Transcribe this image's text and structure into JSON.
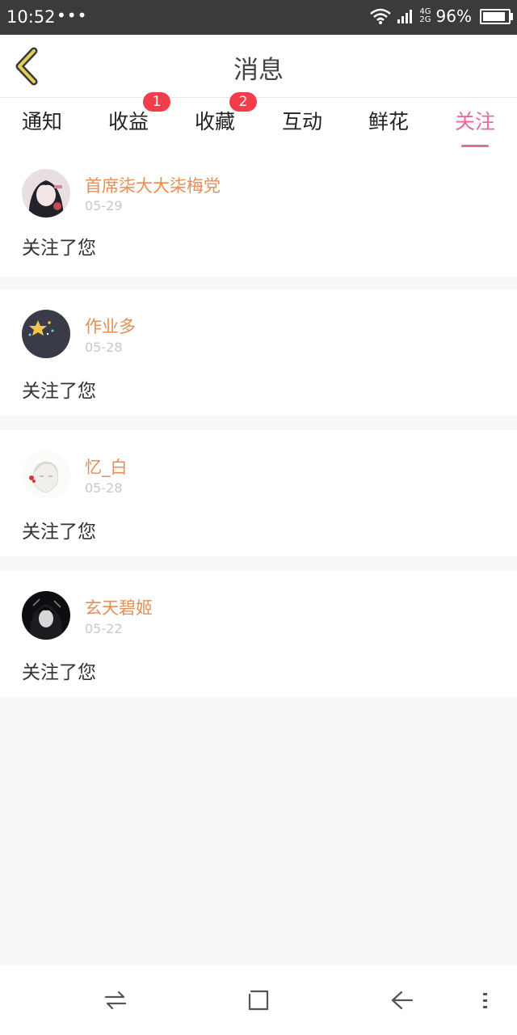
{
  "status_bar": {
    "time": "10:52",
    "dots": "•••",
    "network_top": "4G",
    "network_bottom": "2G",
    "battery_percent": "96%",
    "battery_level": 0.96
  },
  "header": {
    "title": "消息"
  },
  "tabs": [
    {
      "label": "通知",
      "badge": null,
      "active": false
    },
    {
      "label": "收益",
      "badge": "1",
      "active": false
    },
    {
      "label": "收藏",
      "badge": "2",
      "active": false
    },
    {
      "label": "互动",
      "badge": null,
      "active": false
    },
    {
      "label": "鲜花",
      "badge": null,
      "active": false
    },
    {
      "label": "关注",
      "badge": null,
      "active": true
    }
  ],
  "messages": [
    {
      "name": "首席柒大大柒梅党",
      "date": "05-29",
      "text": "关注了您"
    },
    {
      "name": "作业多",
      "date": "05-28",
      "text": "关注了您"
    },
    {
      "name": "忆_白",
      "date": "05-28",
      "text": "关注了您"
    },
    {
      "name": "玄天碧姬",
      "date": "05-22",
      "text": "关注了您"
    }
  ],
  "colors": {
    "accent": "#e96aa0",
    "name": "#e58e55",
    "badge": "#f23d4d",
    "back_icon": "#c9a53a"
  },
  "icons": {
    "back": "chevron-left-icon",
    "nav": [
      "switch-icon",
      "home-square-icon",
      "back-arrow-icon",
      "menu-icon"
    ]
  }
}
